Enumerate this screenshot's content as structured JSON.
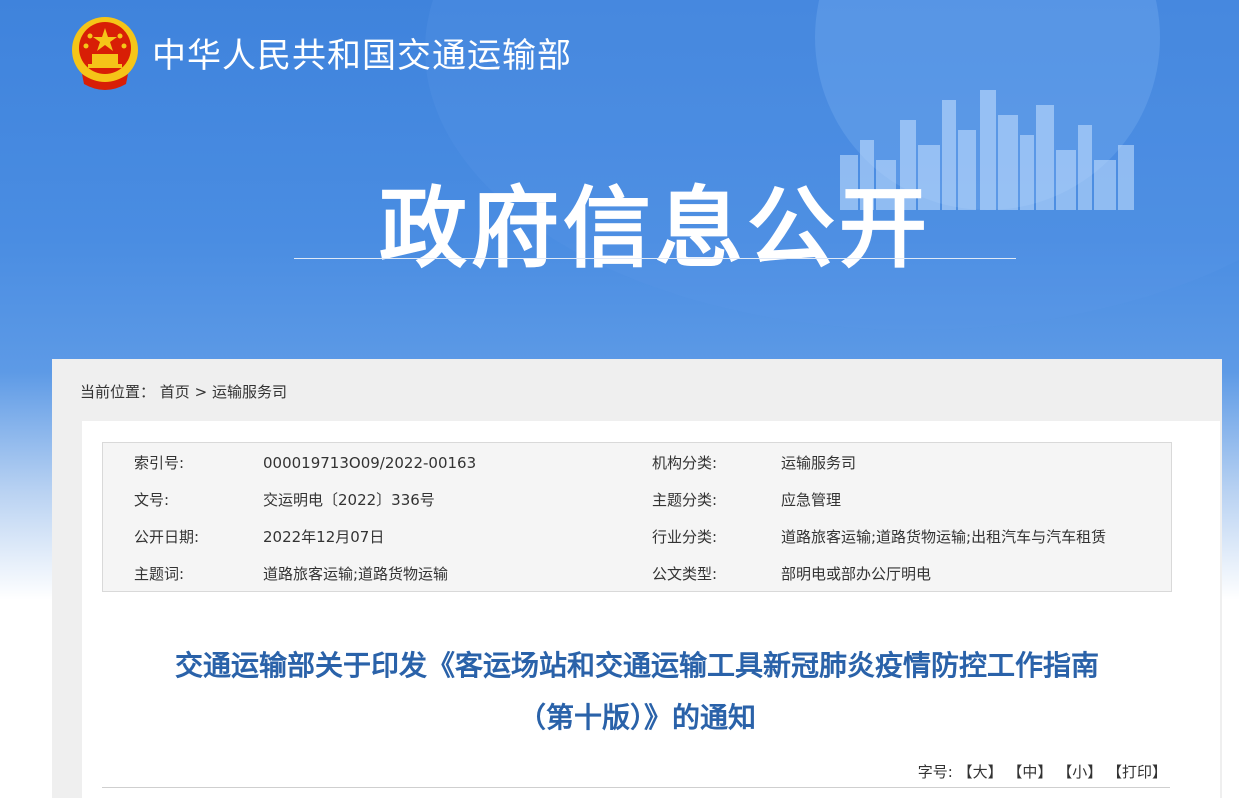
{
  "header": {
    "ministry_name": "中华人民共和国交通运输部",
    "section_title": "政府信息公开"
  },
  "breadcrumb": {
    "prefix": "当前位置：",
    "home": "首页",
    "separator": ">",
    "current": "运输服务司"
  },
  "meta": {
    "rows": [
      {
        "label_left": "索引号:",
        "value_left": "000019713O09/2022-00163",
        "label_right": "机构分类:",
        "value_right": "运输服务司"
      },
      {
        "label_left": "文号:",
        "value_left": "交运明电〔2022〕336号",
        "label_right": "主题分类:",
        "value_right": "应急管理"
      },
      {
        "label_left": "公开日期:",
        "value_left": "2022年12月07日",
        "label_right": "行业分类:",
        "value_right": "道路旅客运输;道路货物运输;出租汽车与汽车租赁"
      },
      {
        "label_left": "主题词:",
        "value_left": "道路旅客运输;道路货物运输",
        "label_right": "公文类型:",
        "value_right": "部明电或部办公厅明电"
      }
    ]
  },
  "article": {
    "title_line1": "交通运输部关于印发《客运场站和交通运输工具新冠肺炎疫情防控工作指南",
    "title_line2": "（第十版）》的通知"
  },
  "tools": {
    "font_label": "字号:",
    "large": "【大】",
    "medium": "【中】",
    "small": "【小】",
    "print": "【打印】"
  },
  "colors": {
    "banner_blue": "#4a8de2",
    "title_blue": "#2a62a9",
    "emblem_red": "#d81e06",
    "emblem_gold": "#f5c518"
  }
}
